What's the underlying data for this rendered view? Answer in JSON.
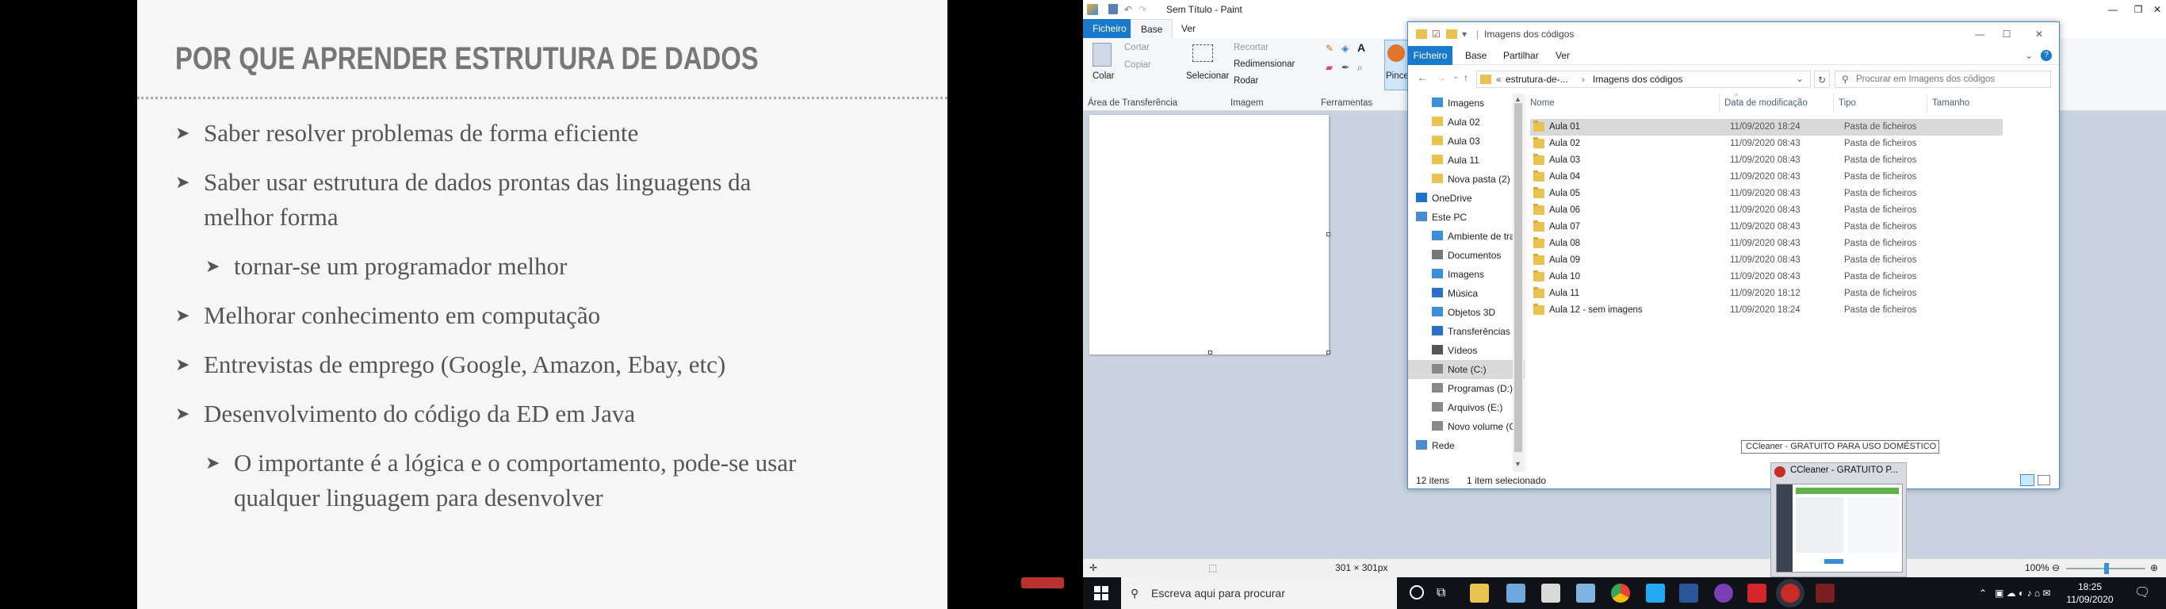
{
  "slide": {
    "title": "POR QUE APRENDER ESTRUTURA DE DADOS",
    "bullets": [
      "Saber resolver problemas de forma eficiente",
      "Saber usar estrutura de dados prontas das linguagens da",
      "melhor forma",
      "tornar-se um programador melhor",
      "Melhorar conhecimento em computação",
      "Entrevistas de emprego (Google, Amazon, Ebay, etc)",
      "Desenvolvimento do código da ED em Java",
      "O importante é a lógica e o comportamento, pode-se usar",
      "qualquer linguagem para desenvolver"
    ],
    "marker": "➤"
  },
  "paint": {
    "title": "Sem Título - Paint",
    "tabs": [
      "Ficheiro",
      "Base",
      "Ver"
    ],
    "clipboard": {
      "paste": "Colar",
      "cut": "Cortar",
      "copy": "Copiar",
      "group": "Área de Transferência"
    },
    "image": {
      "select": "Selecionar",
      "crop": "Recortar",
      "resize": "Redimensionar",
      "rotate": "Rodar",
      "group": "Imagem"
    },
    "tools": {
      "group": "Ferramentas",
      "text_tool": "A"
    },
    "brushes": "Pince",
    "status": {
      "size": "301 × 301px",
      "zoom": "100%"
    }
  },
  "explorer": {
    "title": "Imagens dos códigos",
    "tabs": [
      "Ficheiro",
      "Base",
      "Partilhar",
      "Ver"
    ],
    "breadcrumb": [
      "«",
      "estrutura-de-...",
      "›",
      "Imagens dos códigos"
    ],
    "search_placeholder": "Procurar em Imagens dos códigos",
    "nav": [
      "Imagens",
      "Aula 02",
      "Aula 03",
      "Aula 11",
      "Nova pasta (2)",
      "OneDrive",
      "Este PC",
      "Ambiente de tra",
      "Documentos",
      "Imagens",
      "Música",
      "Objetos 3D",
      "Transferências",
      "Vídeos",
      "Note (C:)",
      "Programas  (D:)",
      "Arquivos (E:)",
      "Novo volume (G",
      "Rede"
    ],
    "columns": [
      "Nome",
      "Data de modificação",
      "Tipo",
      "Tamanho"
    ],
    "rows": [
      {
        "name": "Aula 01",
        "date": "11/09/2020 18:24",
        "type": "Pasta de ficheiros"
      },
      {
        "name": "Aula 02",
        "date": "11/09/2020 08:43",
        "type": "Pasta de ficheiros"
      },
      {
        "name": "Aula 03",
        "date": "11/09/2020 08:43",
        "type": "Pasta de ficheiros"
      },
      {
        "name": "Aula 04",
        "date": "11/09/2020 08:43",
        "type": "Pasta de ficheiros"
      },
      {
        "name": "Aula 05",
        "date": "11/09/2020 08:43",
        "type": "Pasta de ficheiros"
      },
      {
        "name": "Aula 06",
        "date": "11/09/2020 08:43",
        "type": "Pasta de ficheiros"
      },
      {
        "name": "Aula 07",
        "date": "11/09/2020 08:43",
        "type": "Pasta de ficheiros"
      },
      {
        "name": "Aula 08",
        "date": "11/09/2020 08:43",
        "type": "Pasta de ficheiros"
      },
      {
        "name": "Aula 09",
        "date": "11/09/2020 08:43",
        "type": "Pasta de ficheiros"
      },
      {
        "name": "Aula 10",
        "date": "11/09/2020 08:43",
        "type": "Pasta de ficheiros"
      },
      {
        "name": "Aula 11",
        "date": "11/09/2020 18:12",
        "type": "Pasta de ficheiros"
      },
      {
        "name": "Aula 12 - sem imagens",
        "date": "11/09/2020 18:24",
        "type": "Pasta de ficheiros"
      }
    ],
    "status": {
      "count": "12 itens",
      "selected": "1 item selecionado"
    }
  },
  "ccleaner": {
    "tooltip": "CCleaner - GRATUITO PARA USO DOMÉSTICO",
    "thumb_title": "CCleaner - GRATUITO P..."
  },
  "taskbar": {
    "search_placeholder": "Escreva aqui para procurar",
    "time": "18:25",
    "date": "11/09/2020"
  },
  "colors": {
    "accent": "#1979ca",
    "selected_row": "#cce8ff",
    "folder": "#e8c352"
  }
}
